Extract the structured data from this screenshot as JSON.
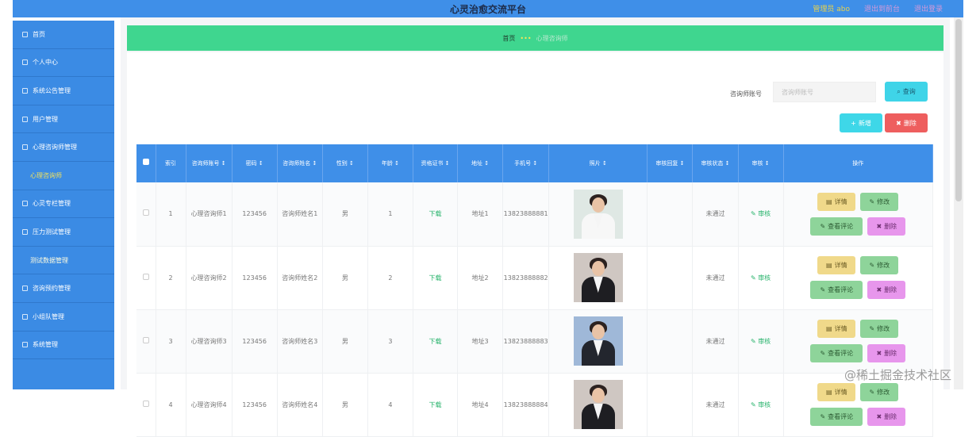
{
  "header": {
    "title": "心灵治愈交流平台",
    "admin": "管理员 abo",
    "link1": "退出到前台",
    "link2": "退出登录"
  },
  "sidebar": {
    "items": [
      {
        "label": "首页",
        "sub": false
      },
      {
        "label": "个人中心",
        "sub": false
      },
      {
        "label": "系统公告管理",
        "sub": false
      },
      {
        "label": "用户管理",
        "sub": false
      },
      {
        "label": "心理咨询师管理",
        "sub": false
      },
      {
        "label": "心理咨询师",
        "sub": true,
        "active": true
      },
      {
        "label": "心灵专栏管理",
        "sub": false
      },
      {
        "label": "压力测试管理",
        "sub": false
      },
      {
        "label": "测试数据管理",
        "sub": true
      },
      {
        "label": "咨询预约管理",
        "sub": false
      },
      {
        "label": "小组队管理",
        "sub": false
      },
      {
        "label": "系统管理",
        "sub": false
      }
    ]
  },
  "breadcrumb": {
    "home": "首页",
    "sep": "•••",
    "current": "心理咨询师"
  },
  "search": {
    "label": "咨询师账号",
    "placeholder": "咨询师账号",
    "button": "查询"
  },
  "toolbar": {
    "add": "新增",
    "delete": "删除"
  },
  "table": {
    "columns": [
      "索引",
      "咨询师账号 ↕",
      "密码 ↕",
      "咨询师姓名 ↕",
      "性别 ↕",
      "年龄 ↕",
      "资格证书 ↕",
      "地址 ↕",
      "手机号 ↕",
      "照片 ↕",
      "审核回复 ↕",
      "审核状态 ↕",
      "审核 ↕",
      "操作"
    ],
    "rows": [
      {
        "index": "1",
        "account": "心理咨询师1",
        "password": "123456",
        "name": "咨询师姓名1",
        "gender": "男",
        "age": "1",
        "cert": "下载",
        "address": "地址1",
        "phone": "13823888881",
        "reply": "",
        "status": "未通过",
        "audit": "审核",
        "photo": "female-white"
      },
      {
        "index": "2",
        "account": "心理咨询师2",
        "password": "123456",
        "name": "咨询师姓名2",
        "gender": "男",
        "age": "2",
        "cert": "下载",
        "address": "地址2",
        "phone": "13823888882",
        "reply": "",
        "status": "未通过",
        "audit": "审核",
        "photo": "female-black"
      },
      {
        "index": "3",
        "account": "心理咨询师3",
        "password": "123456",
        "name": "咨询师姓名3",
        "gender": "男",
        "age": "3",
        "cert": "下载",
        "address": "地址3",
        "phone": "13823888883",
        "reply": "",
        "status": "未通过",
        "audit": "审核",
        "photo": "male-suit"
      },
      {
        "index": "4",
        "account": "心理咨询师4",
        "password": "123456",
        "name": "咨询师姓名4",
        "gender": "男",
        "age": "4",
        "cert": "下载",
        "address": "地址4",
        "phone": "13823888884",
        "reply": "",
        "status": "未通过",
        "audit": "审核",
        "photo": "female-black"
      }
    ],
    "actions": {
      "detail": "详情",
      "edit": "修改",
      "review": "查看评论",
      "delete": "删除"
    }
  },
  "watermark": "@稀土掘金技术社区",
  "colors": {
    "sidebar": "#3b8be4",
    "header": "#3f8fe8",
    "breadcrumb": "#3fd68f",
    "detail": "#f0d98a",
    "edit": "#8ed49a",
    "delete": "#e796ec"
  }
}
